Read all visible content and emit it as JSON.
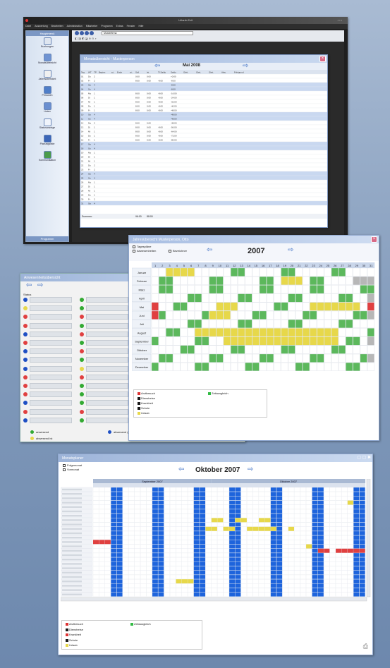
{
  "main_window": {
    "title": "Urlaub-Zeit",
    "menu": [
      "Datei",
      "Auswertung",
      "Bearbeiten",
      "Administration",
      "Mitarbeiter",
      "Programm",
      "Extras",
      "Fenster",
      "Hilfe"
    ],
    "toolbar_address": "Musterfirma",
    "sidebar": {
      "header": "Hauptmenü",
      "items": [
        "Buchungen",
        "Monatsübersicht",
        "Jahresübersicht",
        "Personen",
        "Listen",
        "Statusanzeige",
        "Planungsliste",
        "Kommunikation"
      ],
      "footer": "Programm"
    }
  },
  "monthly": {
    "title": "Monatsübersicht - Musterperson",
    "month_label": "Mai 2008",
    "columns": [
      "Tag",
      "WT",
      "TP",
      "Beginn",
      "a.t.",
      "Ende",
      "a.t.",
      "Soll",
      "Ist",
      "Tf.Saldo",
      "Saldo",
      "Gleit.",
      "Gleit.",
      "Gleit.",
      "Abw.",
      "Fehlgrund"
    ],
    "rows": [
      [
        "01",
        "Do",
        "2",
        "",
        "",
        "",
        "",
        "0:00",
        "0:00",
        "",
        "+0:00",
        "",
        "",
        "",
        "",
        ""
      ],
      [
        "02",
        "Fr",
        "2",
        "",
        "",
        "",
        "",
        "8:00",
        "0:00",
        "-8:00",
        "-8:00",
        "",
        "",
        "",
        "",
        ""
      ],
      [
        "03",
        "Sa",
        "4",
        "",
        "",
        "",
        "",
        "",
        "",
        "",
        "-8:00",
        "",
        "",
        "",
        "",
        ""
      ],
      [
        "04",
        "So",
        "4",
        "",
        "",
        "",
        "",
        "",
        "",
        "",
        "-8:00",
        "",
        "",
        "",
        "",
        ""
      ],
      [
        "05",
        "Mo",
        "1",
        "",
        "",
        "",
        "",
        "8:00",
        "0:00",
        "-8:00",
        "-16:00",
        "",
        "",
        "",
        "",
        ""
      ],
      [
        "06",
        "Di",
        "1",
        "",
        "",
        "",
        "",
        "8:00",
        "0:00",
        "-8:00",
        "-24:00",
        "",
        "",
        "",
        "",
        ""
      ],
      [
        "07",
        "Mi",
        "1",
        "",
        "",
        "",
        "",
        "8:00",
        "0:00",
        "-8:00",
        "-32:00",
        "",
        "",
        "",
        "",
        ""
      ],
      [
        "08",
        "Do",
        "1",
        "",
        "",
        "",
        "",
        "8:00",
        "0:00",
        "-8:00",
        "-40:00",
        "",
        "",
        "",
        "",
        ""
      ],
      [
        "09",
        "Fr",
        "1",
        "",
        "",
        "",
        "",
        "8:00",
        "0:00",
        "-8:00",
        "-48:00",
        "",
        "",
        "",
        "",
        ""
      ],
      [
        "10",
        "Sa",
        "4",
        "",
        "",
        "",
        "",
        "",
        "",
        "",
        "-48:00",
        "",
        "",
        "",
        "",
        ""
      ],
      [
        "11",
        "So",
        "4",
        "",
        "",
        "",
        "",
        "",
        "",
        "",
        "-48:00",
        "",
        "",
        "",
        "",
        ""
      ],
      [
        "12",
        "Mo",
        "2",
        "",
        "",
        "",
        "",
        "8:00",
        "0:00",
        "",
        "-48:00",
        "",
        "",
        "",
        "",
        ""
      ],
      [
        "13",
        "Di",
        "1",
        "",
        "",
        "",
        "",
        "8:00",
        "0:00",
        "-8:00",
        "-56:00",
        "",
        "",
        "",
        "",
        ""
      ],
      [
        "14",
        "Mi",
        "1",
        "",
        "",
        "",
        "",
        "8:00",
        "0:00",
        "-8:00",
        "-64:00",
        "",
        "",
        "",
        "",
        ""
      ],
      [
        "15",
        "Do",
        "1",
        "",
        "",
        "",
        "",
        "8:00",
        "0:00",
        "-8:00",
        "-72:00",
        "",
        "",
        "",
        "",
        ""
      ],
      [
        "16",
        "Fr",
        "1",
        "",
        "",
        "",
        "",
        "8:00",
        "0:00",
        "-8:00",
        "-80:00",
        "",
        "",
        "",
        "",
        ""
      ],
      [
        "17",
        "Sa",
        "4",
        "",
        "",
        "",
        "",
        "",
        "",
        "",
        "",
        "",
        "",
        "",
        "",
        ""
      ],
      [
        "18",
        "So",
        "4",
        "",
        "",
        "",
        "",
        "",
        "",
        "",
        "",
        "",
        "",
        "",
        "",
        ""
      ],
      [
        "19",
        "Mo",
        "1",
        "",
        "",
        "",
        "",
        "",
        "",
        "",
        "",
        "",
        "",
        "",
        "",
        ""
      ],
      [
        "20",
        "Di",
        "1",
        "",
        "",
        "",
        "",
        "",
        "",
        "",
        "",
        "",
        "",
        "",
        "",
        ""
      ],
      [
        "21",
        "Mi",
        "1",
        "",
        "",
        "",
        "",
        "",
        "",
        "",
        "",
        "",
        "",
        "",
        "",
        ""
      ],
      [
        "22",
        "Do",
        "2",
        "",
        "",
        "",
        "",
        "",
        "",
        "",
        "",
        "",
        "",
        "",
        "",
        ""
      ],
      [
        "23",
        "Fr",
        "2",
        "",
        "",
        "",
        "",
        "",
        "",
        "",
        "",
        "",
        "",
        "",
        "",
        ""
      ],
      [
        "24",
        "Sa",
        "4",
        "",
        "",
        "",
        "",
        "",
        "",
        "",
        "",
        "",
        "",
        "",
        "",
        ""
      ],
      [
        "25",
        "So",
        "4",
        "",
        "",
        "",
        "",
        "",
        "",
        "",
        "",
        "",
        "",
        "",
        "",
        ""
      ],
      [
        "26",
        "Mo",
        "1",
        "",
        "",
        "",
        "",
        "",
        "",
        "",
        "",
        "",
        "",
        "",
        "",
        ""
      ],
      [
        "27",
        "Di",
        "1",
        "",
        "",
        "",
        "",
        "",
        "",
        "",
        "",
        "",
        "",
        "",
        "",
        ""
      ],
      [
        "28",
        "Mi",
        "1",
        "",
        "",
        "",
        "",
        "",
        "",
        "",
        "",
        "",
        "",
        "",
        "",
        ""
      ],
      [
        "29",
        "Do",
        "1",
        "",
        "",
        "",
        "",
        "",
        "",
        "",
        "",
        "",
        "",
        "",
        "",
        ""
      ],
      [
        "30",
        "Fr",
        "2",
        "",
        "",
        "",
        "",
        "",
        "",
        "",
        "",
        "",
        "",
        "",
        "",
        ""
      ],
      [
        "31",
        "Sa",
        "4",
        "",
        "",
        "",
        "",
        "",
        "",
        "",
        "",
        "",
        "",
        "",
        "",
        ""
      ]
    ],
    "weekend_rows": [
      2,
      3,
      9,
      10,
      16,
      17,
      23,
      24,
      30
    ],
    "summary_label": "Summen:",
    "summary_values": [
      "96:00",
      "88:00"
    ]
  },
  "yearly": {
    "title": "Jahresübersicht Musterperson, Otto",
    "year": "2007",
    "check_daily": "Tagespläne",
    "check_absence": "Abwesenheiten",
    "check_names": "Bezeichner",
    "months": [
      "Januar",
      "Februar",
      "März",
      "April",
      "Mai",
      "Juni",
      "Juli",
      "August",
      "September",
      "Oktober",
      "November",
      "Dezember"
    ],
    "days": [
      "1",
      "2",
      "3",
      "4",
      "5",
      "6",
      "7",
      "8",
      "9",
      "10",
      "11",
      "12",
      "13",
      "14",
      "15",
      "16",
      "17",
      "18",
      "19",
      "20",
      "21",
      "22",
      "23",
      "24",
      "25",
      "26",
      "27",
      "28",
      "29",
      "30",
      "31"
    ],
    "legend_left": [
      {
        "code": "F!",
        "label": "Arztbesuch",
        "color": "#dd3333"
      },
      {
        "code": "F!",
        "label": "Dienstreise",
        "color": "#1a1a1a"
      },
      {
        "code": "F!",
        "label": "Krankheit",
        "color": "#1a1a1a"
      },
      {
        "code": "F!",
        "label": "Schule",
        "color": "#1a1a1a"
      },
      {
        "code": "F!",
        "label": "Urlaub",
        "color": "#e7d84a"
      }
    ],
    "legend_right": [
      {
        "code": "F!",
        "label": "Zeitausgleich",
        "color": "#33bb44"
      }
    ]
  },
  "presence": {
    "title": "Anwesenheitsübersicht",
    "status_header": "Status",
    "legend_present": "anwesend",
    "legend_absent_soon": "abwesend (nur kurz abwesend)",
    "legend_absent": "abwesend ist"
  },
  "monthly_planner": {
    "title": "Monatsplaner",
    "check_followmonth": "Folgemonat",
    "check_prevmonth": "Vormonat",
    "month_label": "Oktober 2007",
    "left_header": "September 2007",
    "right_header": "Oktober 2007",
    "legend_left": [
      {
        "code": "F!",
        "label": "Arztbesuch",
        "color": "#dd3333"
      },
      {
        "code": "F!",
        "label": "Dienstreise",
        "color": "#1a1a1a"
      },
      {
        "code": "F!",
        "label": "Krankheit",
        "color": "#dd3333"
      },
      {
        "code": "F!",
        "label": "Schule",
        "color": "#1a1a1a"
      },
      {
        "code": "F!",
        "label": "Urlaub",
        "color": "#e7d84a"
      }
    ],
    "legend_right": [
      {
        "code": "F!",
        "label": "Zeitausgleich",
        "color": "#33bb44"
      }
    ]
  },
  "colors": {
    "weekend_green": "#5cb85c",
    "vacation_yellow": "#e7d84a",
    "sick_red": "#e04040",
    "planner_blue": "#1e64dc",
    "highlight_blue": "#c9d8f0"
  }
}
